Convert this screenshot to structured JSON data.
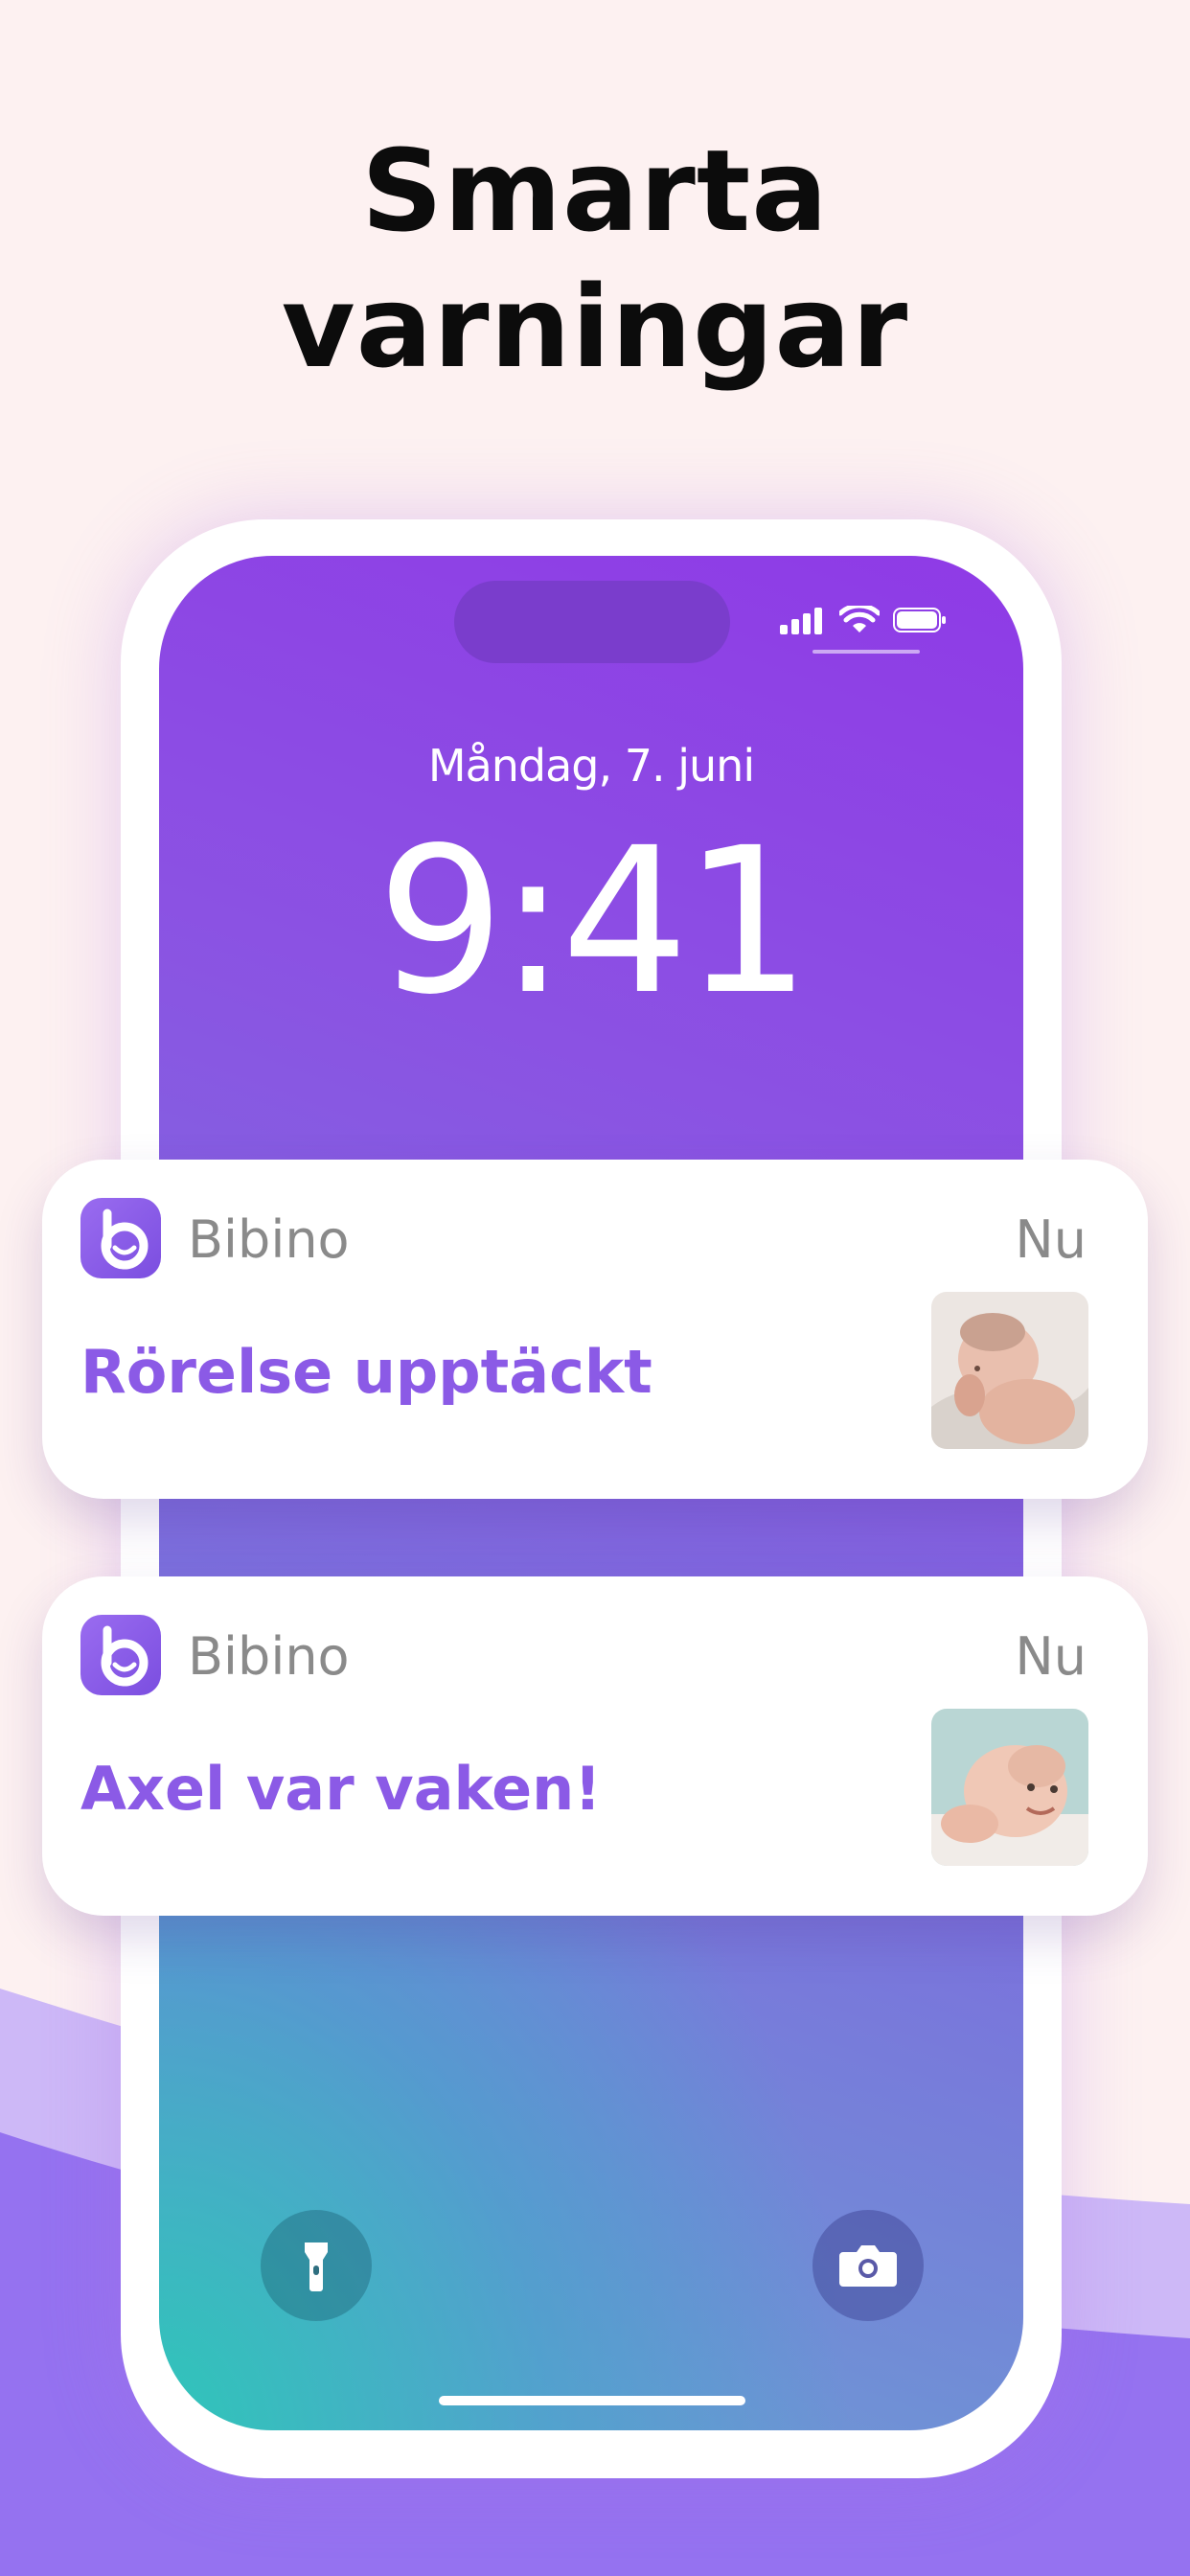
{
  "headline": {
    "line1": "Smarta",
    "line2": "varningar"
  },
  "lockscreen": {
    "date": "Måndag, 7. juni",
    "time": "9:41"
  },
  "status_icons": [
    "signal-icon",
    "wifi-icon",
    "battery-icon"
  ],
  "quick_actions": [
    "flashlight-icon",
    "camera-icon"
  ],
  "notifications": [
    {
      "app": "Bibino",
      "when": "Nu",
      "message": "Rörelse upptäckt",
      "thumbnail": "baby-photo"
    },
    {
      "app": "Bibino",
      "when": "Nu",
      "message": "Axel var vaken!",
      "thumbnail": "baby-photo"
    }
  ],
  "colors": {
    "accent": "#8b5ae6",
    "background": "#fdf1f1",
    "wave": "#9572f0",
    "app_icon": "#8a5ce8"
  }
}
